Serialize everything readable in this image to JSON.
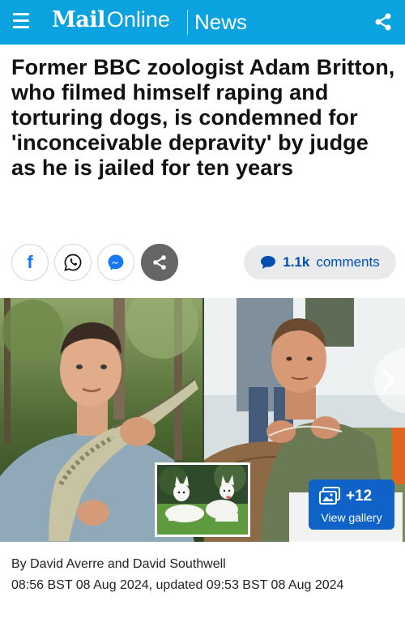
{
  "header": {
    "brand_bold": "Mail",
    "brand_light": "Online",
    "section": "News",
    "bg_color": "#0aa3e0",
    "menu_icon": "hamburger-menu-icon",
    "share_icon": "share-icon"
  },
  "article": {
    "headline": "Former BBC zoologist Adam Britton, who filmed himself raping and torturing dogs, is condemned for 'inconceivable depravity' by judge as he is jailed for ten years",
    "byline": "By David Averre and David Southwell",
    "timestamp": "08:56 BST 08 Aug 2024, updated 09:53 BST 08 Aug 2024"
  },
  "share_bar": {
    "buttons": [
      {
        "icon": "facebook-icon"
      },
      {
        "icon": "whatsapp-icon"
      },
      {
        "icon": "messenger-icon"
      },
      {
        "icon": "share-icon"
      }
    ],
    "comments_count": "1.1k",
    "comments_label": "comments",
    "accent_color": "#004db3"
  },
  "gallery": {
    "count_label": "+12",
    "button_label": "View gallery",
    "button_color": "#0f63c8"
  }
}
